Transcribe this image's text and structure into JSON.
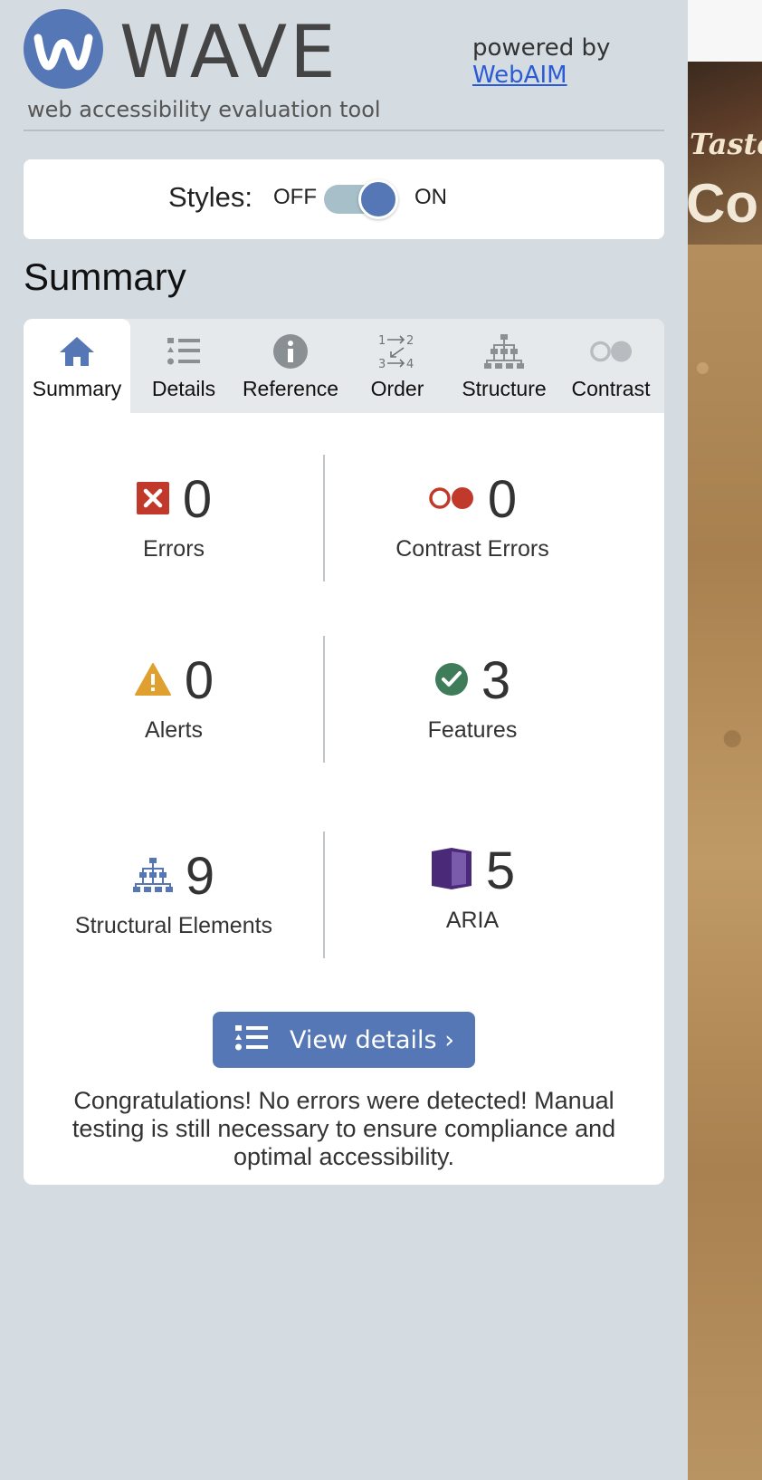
{
  "brand": {
    "title": "WAVE",
    "tagline": "web accessibility evaluation tool",
    "powered_by": "powered by",
    "webaim_link": "WebAIM"
  },
  "styles_toggle": {
    "label": "Styles:",
    "off_label": "OFF",
    "on_label": "ON",
    "state": "on"
  },
  "summary_heading": "Summary",
  "tabs": [
    {
      "label": "Summary",
      "icon": "home-icon",
      "active": true
    },
    {
      "label": "Details",
      "icon": "list-icon",
      "active": false
    },
    {
      "label": "Reference",
      "icon": "info-icon",
      "active": false
    },
    {
      "label": "Order",
      "icon": "order-icon",
      "active": false
    },
    {
      "label": "Structure",
      "icon": "structure-icon",
      "active": false
    },
    {
      "label": "Contrast",
      "icon": "contrast-icon",
      "active": false
    }
  ],
  "stats": {
    "errors": {
      "count": "0",
      "label": "Errors",
      "icon": "error-icon"
    },
    "contrast_errors": {
      "count": "0",
      "label": "Contrast Errors",
      "icon": "contrast-error-icon"
    },
    "alerts": {
      "count": "0",
      "label": "Alerts",
      "icon": "alert-icon"
    },
    "features": {
      "count": "3",
      "label": "Features",
      "icon": "feature-check-icon"
    },
    "structural": {
      "count": "9",
      "label": "Structural Elements",
      "icon": "structure-icon"
    },
    "aria": {
      "count": "5",
      "label": "ARIA",
      "icon": "aria-box-icon"
    }
  },
  "view_details_label": "View details ›",
  "congrats_message": "Congratulations! No errors were detected! Manual testing is still necessary to ensure compliance and optimal accessibility.",
  "preview": {
    "taste_text": "Taste",
    "co_text": "Co"
  },
  "colors": {
    "accent": "#5577b5",
    "error": "#c0392b",
    "alert": "#e0a030",
    "feature": "#3f7d5a",
    "aria": "#4a2a78"
  }
}
